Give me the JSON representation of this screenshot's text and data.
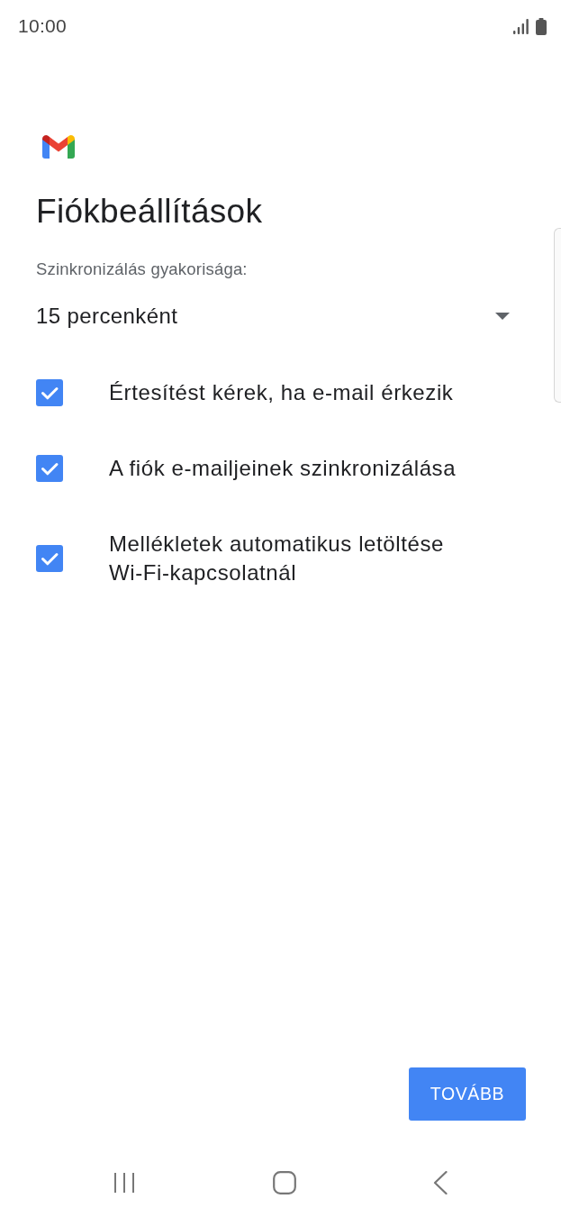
{
  "status_bar": {
    "time": "10:00"
  },
  "title": "Fiókbeállítások",
  "sync_frequency": {
    "label": "Szinkronizálás gyakorisága:",
    "value": "15 percenként"
  },
  "options": [
    {
      "label": "Értesítést kérek, ha e-mail érkezik",
      "checked": true
    },
    {
      "label": "A fiók e-mailjeinek szinkronizálása",
      "checked": true
    },
    {
      "label": "Mellékletek automatikus letöltése Wi-Fi-kapcsolatnál",
      "checked": true
    }
  ],
  "buttons": [
    {
      "label": "TOVÁBB"
    }
  ]
}
